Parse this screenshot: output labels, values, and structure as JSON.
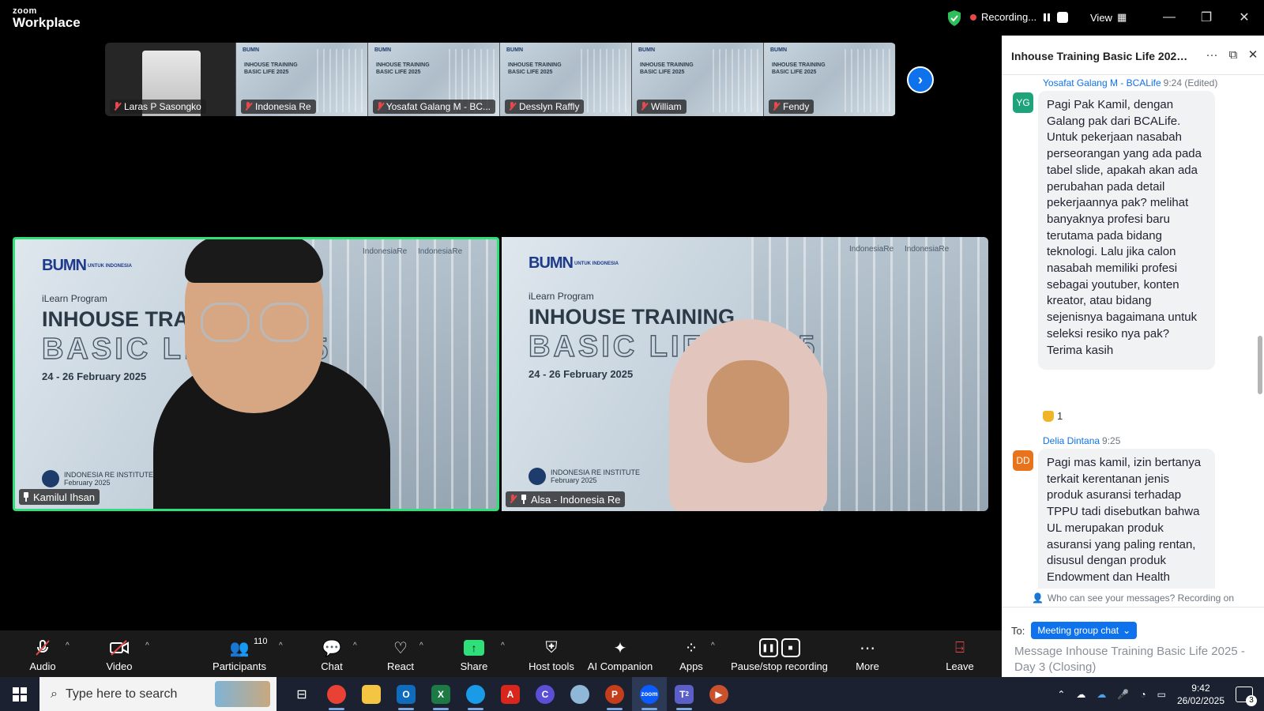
{
  "app": {
    "logo_top": "zoom",
    "logo_bottom": "Workplace",
    "recording_label": "Recording...",
    "view_label": "View"
  },
  "thumbnails": [
    {
      "name": "Laras P Sasongko",
      "type": "person"
    },
    {
      "name": "Indonesia Re",
      "type": "slide"
    },
    {
      "name": "Yosafat Galang M - BC...",
      "type": "slide"
    },
    {
      "name": "Desslyn Raffly",
      "type": "slide"
    },
    {
      "name": "William",
      "type": "slide"
    },
    {
      "name": "Fendy",
      "type": "slide"
    }
  ],
  "slide": {
    "bumn": "BUMN",
    "bumn_sub": "UNTUK INDONESIA",
    "ire": "IndonesiaRe",
    "ire2": "IndonesiaRe",
    "ilearn": "iLearn Program",
    "title1": "INHOUSE TRAINING",
    "title2": "BASIC LIFE 2025",
    "dates": "24 - 26 February 2025",
    "institute": "INDONESIA RE INSTITUTE",
    "institute_date": "February 2025"
  },
  "videos": {
    "speaker_name": "Kamilul Ihsan",
    "other_name": "Alsa - Indonesia Re"
  },
  "chat": {
    "title": "Inhouse Training Basic Life 2025 - ...",
    "messages": [
      {
        "initials": "YG",
        "avatar_color": "#1fa37a",
        "sender": "Yosafat Galang M - BCALife",
        "time": "9:24 (Edited)",
        "text": "Pagi Pak Kamil, dengan Galang pak dari BCALife. Untuk pekerjaan nasabah perseorangan yang ada pada tabel slide, apakah akan ada perubahan pada detail pekerjaannya pak? melihat banyaknya profesi baru terutama pada bidang teknologi. Lalu jika calon nasabah memiliki profesi sebagai youtuber, konten kreator, atau bidang sejenisnya bagaimana untuk seleksi resiko nya pak? Terima kasih",
        "reaction_count": "1"
      },
      {
        "initials": "DD",
        "avatar_color": "#e8731b",
        "sender": "Delia Dintana",
        "time": "9:25",
        "text": "Pagi mas kamil, izin bertanya terkait kerentanan jenis produk asuransi terhadap TPPU tadi disebutkan bahwa UL merupakan produk asuransi yang paling rentan, disusul dengan produk Endowment dan Health"
      }
    ],
    "privacy_note": "Who can see your messages? Recording on",
    "to_label": "To:",
    "to_value": "Meeting group chat",
    "compose_placeholder": "Message Inhouse Training Basic Life 2025 - Day 3 (Closing)"
  },
  "toolbar": {
    "audio": "Audio",
    "video": "Video",
    "participants": "Participants",
    "participants_count": "110",
    "chat": "Chat",
    "react": "React",
    "share": "Share",
    "host_tools": "Host tools",
    "ai_companion": "AI Companion",
    "apps": "Apps",
    "pause_stop": "Pause/stop recording",
    "more": "More",
    "leave": "Leave"
  },
  "taskbar": {
    "search_placeholder": "Type here to search",
    "time": "9:42",
    "date": "26/02/2025",
    "notifications": "3",
    "teams_badge": "2"
  },
  "colors": {
    "accent": "#0e72ed",
    "active_speaker": "#2fe07a",
    "muted": "#e5484d"
  }
}
